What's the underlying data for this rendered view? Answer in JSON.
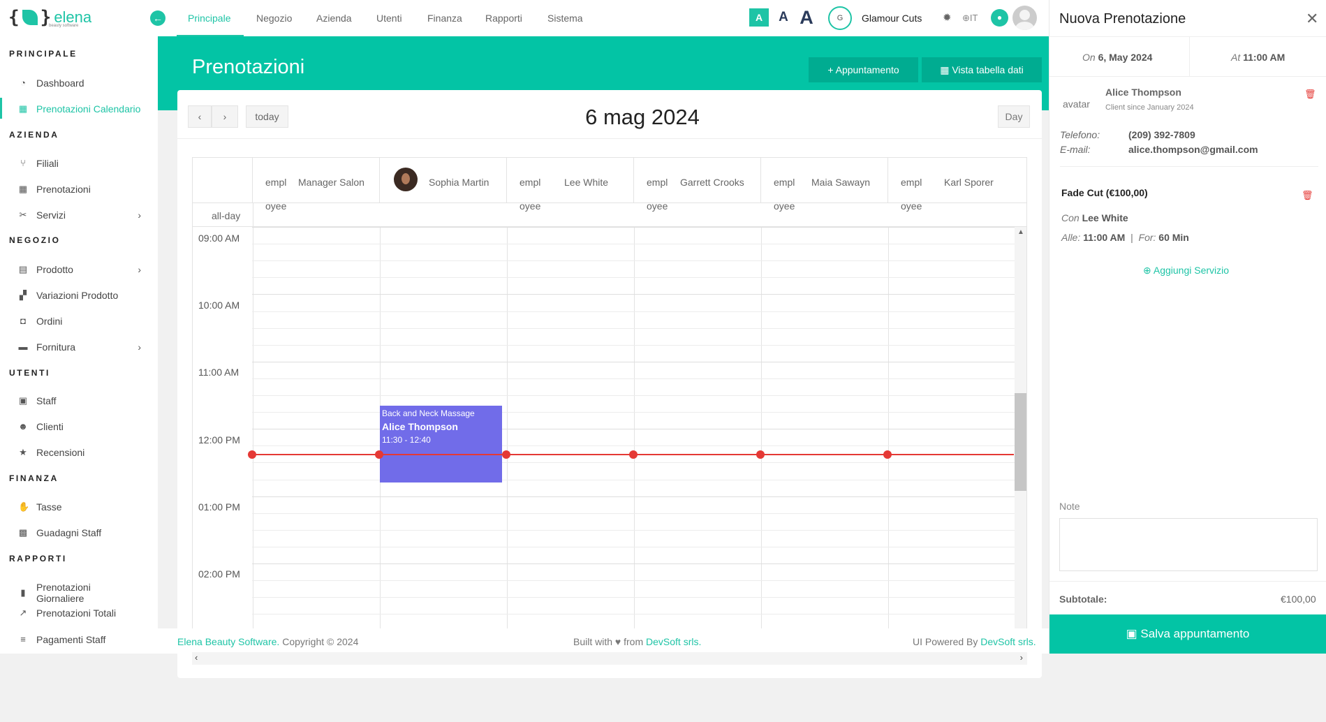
{
  "brand": {
    "name": "elena",
    "tagline": "beauty software"
  },
  "sidebar": {
    "sections": [
      {
        "title": "PRINCIPALE"
      },
      {
        "title": "AZIENDA"
      },
      {
        "title": "NEGOZIO"
      },
      {
        "title": "UTENTI"
      },
      {
        "title": "FINANZA"
      },
      {
        "title": "RAPPORTI"
      }
    ],
    "items": [
      {
        "label": "Dashboard",
        "icon": "dashboard-icon"
      },
      {
        "label": "Prenotazioni Calendario",
        "icon": "calendar-icon",
        "active": true
      },
      {
        "label": "Filiali",
        "icon": "branch-icon"
      },
      {
        "label": "Prenotazioni",
        "icon": "calendar-icon"
      },
      {
        "label": "Servizi",
        "icon": "cut-icon"
      },
      {
        "label": "Prodotto",
        "icon": "store-icon"
      },
      {
        "label": "Variazioni Prodotto",
        "icon": "variations-icon"
      },
      {
        "label": "Ordini",
        "icon": "bag-icon"
      },
      {
        "label": "Fornitura",
        "icon": "truck-icon"
      },
      {
        "label": "Staff",
        "icon": "id-card-icon"
      },
      {
        "label": "Clienti",
        "icon": "users-icon"
      },
      {
        "label": "Recensioni",
        "icon": "star-icon"
      },
      {
        "label": "Tasse",
        "icon": "hand-money-icon"
      },
      {
        "label": "Guadagni Staff",
        "icon": "money-icon"
      },
      {
        "label": "Prenotazioni Giornaliere",
        "icon": "file-icon"
      },
      {
        "label": "Prenotazioni Totali",
        "icon": "chart-line-icon"
      },
      {
        "label": "Pagamenti Staff",
        "icon": "list-icon"
      }
    ]
  },
  "topnav": {
    "tabs": [
      "Principale",
      "Negozio",
      "Azienda",
      "Utenti",
      "Finanza",
      "Rapporti",
      "Sistema"
    ],
    "active": "Principale",
    "font_sizes": [
      "A",
      "A",
      "A"
    ],
    "shop_initial": "G",
    "shop_name": "Glamour Cuts",
    "language": "IT"
  },
  "page": {
    "title": "Prenotazioni",
    "btn_appointment": "Appuntamento",
    "btn_table": "Vista tabella dati"
  },
  "calendar": {
    "date": "6 mag 2024",
    "today_label": "today",
    "view_label": "Day",
    "allday_label": "all-day",
    "columns": [
      {
        "pre": "empl",
        "name": "Manager Salon",
        "post": "oyee"
      },
      {
        "pre": "",
        "name": "Sophia Martin",
        "post": ""
      },
      {
        "pre": "empl",
        "name": "Lee White",
        "post": "oyee"
      },
      {
        "pre": "empl",
        "name": "Garrett Crooks",
        "post": "oyee"
      },
      {
        "pre": "empl",
        "name": "Maia Sawayn",
        "post": "oyee"
      },
      {
        "pre": "empl",
        "name": "Karl Sporer",
        "post": "oyee"
      }
    ],
    "times": [
      "09:00 AM",
      "10:00 AM",
      "11:00 AM",
      "12:00 PM",
      "01:00 PM",
      "02:00 PM"
    ],
    "event": {
      "service": "Back and Neck Massage",
      "client": "Alice Thompson",
      "time": "11:30 - 12:40",
      "color": "#716ce9"
    }
  },
  "footer": {
    "left_link": "Elena Beauty Software.",
    "left_text": " Copyright © 2024",
    "mid_text": "Built with ♥ from ",
    "mid_link": "DevSoft srls.",
    "right_text": "UI Powered By ",
    "right_link": "DevSoft srls."
  },
  "panel": {
    "title": "Nuova Prenotazione",
    "on_label": "On",
    "on_value": "6, May 2024",
    "at_label": "At",
    "at_value": "11:00 AM",
    "avatar_alt": "avatar",
    "client_name": "Alice Thompson",
    "client_since": "Client since January 2024",
    "phone_label": "Telefono:",
    "phone": "(209) 392-7809",
    "email_label": "E-mail:",
    "email": "alice.thompson@gmail.com",
    "service": "Fade Cut (€100,00)",
    "with_label": "Con",
    "with_value": "Lee White",
    "at2_label": "Alle:",
    "at2_value": "11:00 AM",
    "for_label": "For:",
    "for_value": "60 Min",
    "add_service": "Aggiungi Servizio",
    "note_label": "Note",
    "subtotal_label": "Subtotale:",
    "subtotal_value": "€100,00",
    "save": "Salva appuntamento"
  },
  "colors": {
    "accent": "#03c4a5",
    "event": "#716ce9",
    "now_line": "#e53935"
  }
}
